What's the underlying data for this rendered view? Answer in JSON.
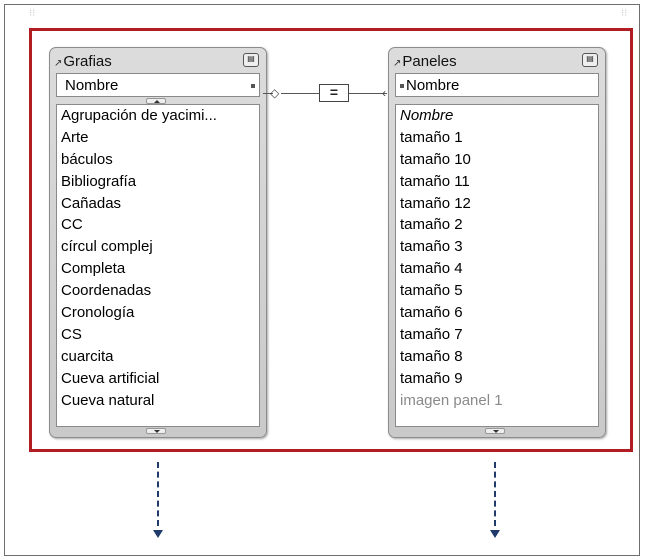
{
  "tables": [
    {
      "title": "Grafias",
      "key_field": "Nombre",
      "items": [
        "Agrupación de yacimi...",
        "Arte",
        "báculos",
        "Bibliografía",
        "Cañadas",
        "CC",
        "círcul complej",
        "Completa",
        "Coordenadas",
        "Cronología",
        "CS",
        "cuarcita",
        "Cueva artificial",
        "Cueva natural"
      ]
    },
    {
      "title": "Paneles",
      "key_field": "Nombre",
      "items": [
        "Nombre",
        "tamaño 1",
        "tamaño 10",
        "tamaño 11",
        "tamaño 12",
        "tamaño 2",
        "tamaño 3",
        "tamaño 4",
        "tamaño 5",
        "tamaño 6",
        "tamaño 7",
        "tamaño 8",
        "tamaño 9",
        "imagen panel 1"
      ]
    }
  ],
  "relationship": {
    "operator": "="
  },
  "icons": {
    "pin": "pin-icon",
    "collapse": "collapse-icon",
    "scroll_up": "scroll-up-icon",
    "scroll_down": "scroll-down-icon",
    "arrow": "arrow-down-icon"
  },
  "colors": {
    "selection_border": "#b01e24",
    "arrow": "#1f3a6b"
  }
}
